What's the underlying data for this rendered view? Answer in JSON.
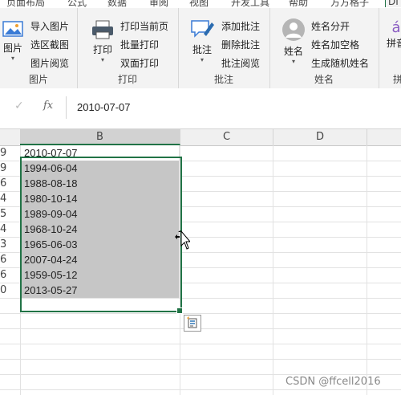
{
  "tabs": [
    "页面布局",
    "公式",
    "数据",
    "审阅",
    "视图",
    "开发工具",
    "帮助",
    "方方格子",
    "DI"
  ],
  "ribbon": {
    "groups": [
      {
        "label": "图片",
        "big": "图片",
        "items": [
          "导入图片",
          "选区截图",
          "图片阅览"
        ]
      },
      {
        "label": "打印",
        "big": "打印",
        "items": [
          "打印当前页",
          "批量打印",
          "双面打印"
        ]
      },
      {
        "label": "批注",
        "big": "批注",
        "items": [
          "添加批注",
          "删除批注",
          "批注阅览"
        ]
      },
      {
        "label": "姓名",
        "big": "姓名",
        "items": [
          "姓名分开",
          "姓名加空格",
          "生成随机姓名"
        ]
      },
      {
        "label": "拼",
        "big": "拼音",
        "items": []
      }
    ]
  },
  "formula_bar": {
    "cancel_icon": "check-icon",
    "fx_label": "fx",
    "value": "2010-07-07"
  },
  "columns": [
    "B",
    "C",
    "D"
  ],
  "rows": [
    {
      "num": "9",
      "b": "2010-07-07"
    },
    {
      "num": "9",
      "b": "1994-06-04"
    },
    {
      "num": "6",
      "b": "1988-08-18"
    },
    {
      "num": "4",
      "b": "1980-10-14"
    },
    {
      "num": "5",
      "b": "1989-09-04"
    },
    {
      "num": "4",
      "b": "1968-10-24"
    },
    {
      "num": "3",
      "b": "1965-06-03"
    },
    {
      "num": "6",
      "b": "2007-04-24"
    },
    {
      "num": "6",
      "b": "1959-05-12"
    },
    {
      "num": "0",
      "b": "2013-05-27"
    }
  ],
  "colors": {
    "selection_border": "#217346",
    "selection_fill": "#c6c6c6"
  },
  "watermark": "CSDN @ffcell2016"
}
